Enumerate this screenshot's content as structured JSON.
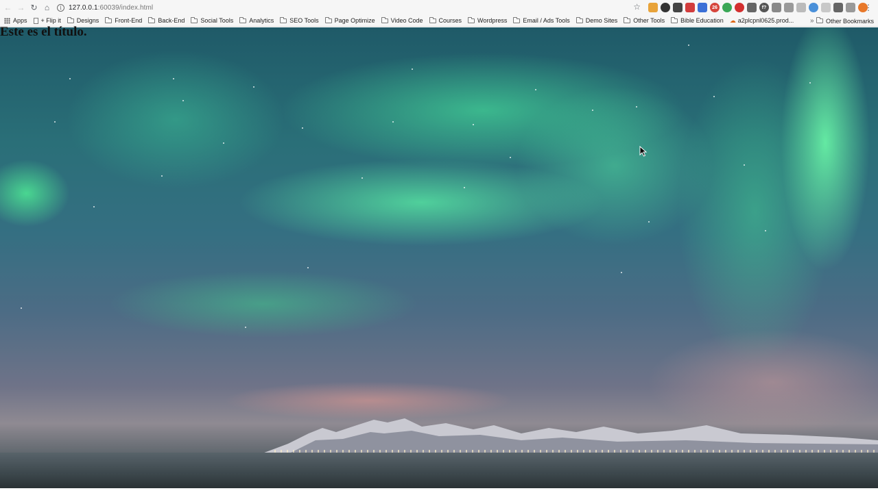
{
  "browser": {
    "url_host": "127.0.0.1",
    "url_rest": ":60039/index.html",
    "extensions": [
      {
        "icon": "bookmark-flag-icon",
        "color": "#e8a33a"
      },
      {
        "icon": "dark-circle-icon",
        "color": "#333333"
      },
      {
        "icon": "pocket-icon",
        "color": "#444444"
      },
      {
        "icon": "red-ext-icon",
        "color": "#d23c3c"
      },
      {
        "icon": "blue-ext-icon",
        "color": "#3b6fd6"
      },
      {
        "icon": "calendar-ext-icon",
        "color": "#d6453b",
        "text": "26"
      },
      {
        "icon": "green-circle-icon",
        "color": "#3aa756"
      },
      {
        "icon": "opera-icon",
        "color": "#d32f2f"
      },
      {
        "icon": "cast-screen-icon",
        "color": "#666666"
      },
      {
        "icon": "formula-icon",
        "color": "#555555",
        "text": "f?"
      },
      {
        "icon": "screen-share-icon",
        "color": "#888888"
      },
      {
        "icon": "vuejs-icon",
        "color": "#9a9a9a"
      },
      {
        "icon": "grey-ext-icon",
        "color": "#bbbbbb"
      },
      {
        "icon": "blue-window-icon",
        "color": "#4a90d9"
      },
      {
        "icon": "grey-square-icon",
        "color": "#c8c8c8"
      },
      {
        "icon": "refresh-ext-icon",
        "color": "#666666"
      },
      {
        "icon": "font-ext-icon",
        "color": "#999999"
      },
      {
        "icon": "orange-ext-icon",
        "color": "#e8782a"
      }
    ]
  },
  "bookmarks": {
    "apps": "Apps",
    "items": [
      {
        "label": "+ Flip it",
        "type": "page"
      },
      {
        "label": "Designs",
        "type": "folder"
      },
      {
        "label": "Front-End",
        "type": "folder"
      },
      {
        "label": "Back-End",
        "type": "folder"
      },
      {
        "label": "Social Tools",
        "type": "folder"
      },
      {
        "label": "Analytics",
        "type": "folder"
      },
      {
        "label": "SEO Tools",
        "type": "folder"
      },
      {
        "label": "Page Optimize",
        "type": "folder"
      },
      {
        "label": "Video Code",
        "type": "folder"
      },
      {
        "label": "Courses",
        "type": "folder"
      },
      {
        "label": "Wordpress",
        "type": "folder"
      },
      {
        "label": "Email / Ads Tools",
        "type": "folder"
      },
      {
        "label": "Demo Sites",
        "type": "folder"
      },
      {
        "label": "Other Tools",
        "type": "folder"
      },
      {
        "label": "Bible Education",
        "type": "folder"
      },
      {
        "label": "a2plcpnl0625.prod...",
        "type": "a2"
      }
    ],
    "more": "»",
    "other": "Other Bookmarks"
  },
  "page": {
    "title": "Este es el título."
  }
}
